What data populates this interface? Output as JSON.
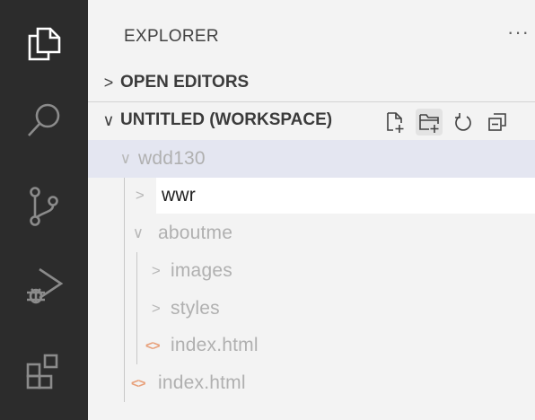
{
  "activity_bar": {
    "icons": [
      "files-icon",
      "search-icon",
      "source-control-icon",
      "run-debug-icon",
      "extensions-icon"
    ]
  },
  "explorer": {
    "title": "EXPLORER",
    "more": "···",
    "open_editors": "OPEN EDITORS",
    "workspace": "UNTITLED (WORKSPACE)",
    "workspace_actions": [
      "new-file-icon",
      "new-folder-icon",
      "refresh-icon",
      "collapse-all-icon"
    ]
  },
  "tree": {
    "root": "wdd130",
    "editing_value": "wwr",
    "aboutme": "aboutme",
    "images": "images",
    "styles": "styles",
    "aboutme_index": "index.html",
    "root_index": "index.html",
    "html_glyph": "<>"
  },
  "colors": {
    "activity_bg": "#2c2c2c",
    "sidebar_bg": "#f3f3f3",
    "selection_bg": "#e4e6f1",
    "html_icon": "#e8a07a"
  }
}
